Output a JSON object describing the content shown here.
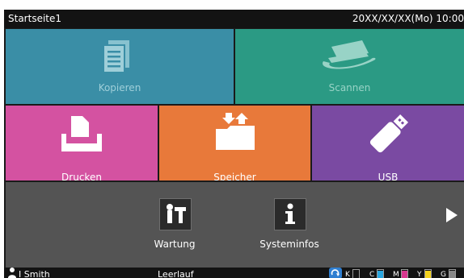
{
  "header": {
    "home_title": "Startseite1",
    "datetime": "20XX/XX/XX(Mo) 10:00"
  },
  "tiles": [
    {
      "id": "copy",
      "label": "Kopieren",
      "icon": "copy-document-icon",
      "color": "#3a8ea6",
      "enabled": false
    },
    {
      "id": "scan",
      "label": "Scannen",
      "icon": "scanner-icon",
      "color": "#2b9a84",
      "enabled": false
    },
    {
      "id": "print",
      "label": "Drucken",
      "icon": "printer-icon",
      "color": "#d452a1",
      "enabled": true
    },
    {
      "id": "storage",
      "label": "Speicher",
      "icon": "folder-upload-icon",
      "color": "#e8793a",
      "enabled": true
    },
    {
      "id": "usb",
      "label": "USB",
      "icon": "usb-stick-icon",
      "color": "#7a4aa2",
      "enabled": true
    }
  ],
  "apps": [
    {
      "label": "Wartung",
      "icon": "maintenance-tools-icon"
    },
    {
      "label": "Systeminfos",
      "icon": "info-icon"
    }
  ],
  "status": {
    "user": "I Smith",
    "state": "Leerlauf",
    "ink": [
      {
        "label": "K",
        "color": "#ffffff",
        "level": 0.0
      },
      {
        "label": "C",
        "color": "#2aa7e0",
        "level": 0.9
      },
      {
        "label": "M",
        "color": "#d8378f",
        "level": 0.9
      },
      {
        "label": "Y",
        "color": "#f2d21c",
        "level": 0.9
      },
      {
        "label": "G",
        "color": "#888888",
        "level": 0.9
      }
    ]
  }
}
